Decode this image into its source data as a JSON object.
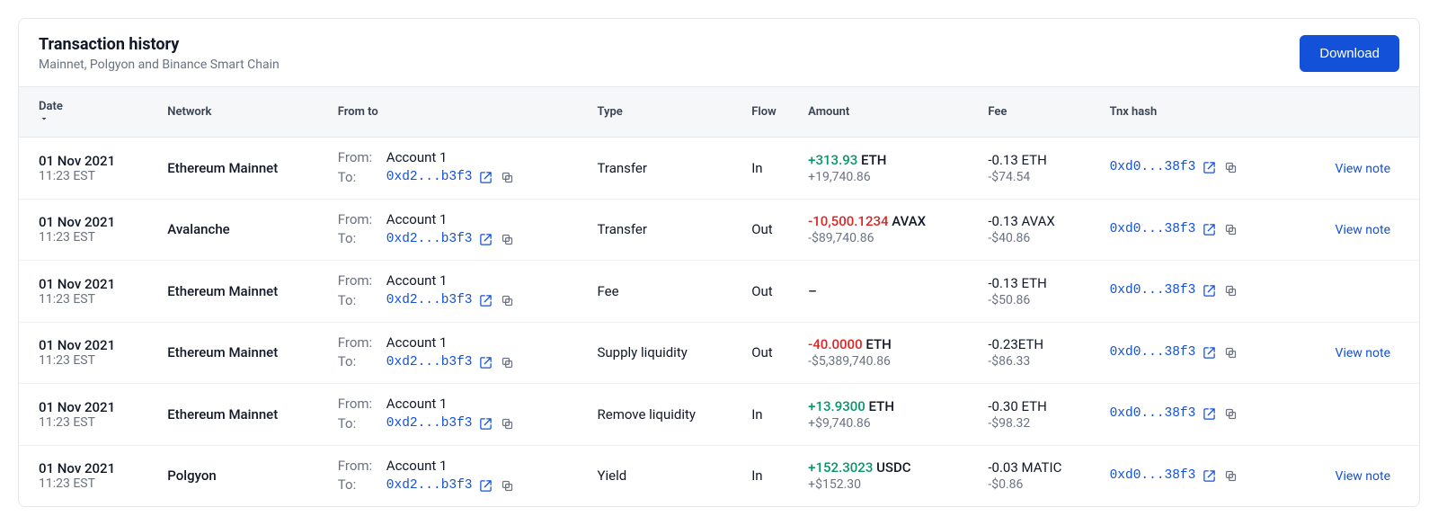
{
  "header": {
    "title": "Transaction history",
    "subtitle": "Mainnet, Polgyon and Binance Smart Chain",
    "download_label": "Download"
  },
  "columns": {
    "date": "Date",
    "network": "Network",
    "fromto": "From to",
    "type": "Type",
    "flow": "Flow",
    "amount": "Amount",
    "fee": "Fee",
    "hash": "Tnx hash"
  },
  "labels": {
    "from": "From:",
    "to": "To:",
    "view_note": "View note"
  },
  "rows": [
    {
      "date": "01 Nov 2021",
      "time": "11:23 EST",
      "network": "Ethereum Mainnet",
      "from": "Account 1",
      "to": "0xd2...b3f3",
      "type": "Transfer",
      "flow": "In",
      "amount_value": "+313.93",
      "amount_symbol": " ETH",
      "amount_class": "amt-green",
      "amount_sub": "+19,740.86",
      "fee_main": "-0.13 ETH",
      "fee_sub": "-$74.54",
      "hash": "0xd0...38f3",
      "has_note": true
    },
    {
      "date": "01 Nov 2021",
      "time": "11:23 EST",
      "network": "Avalanche",
      "from": "Account 1",
      "to": "0xd2...b3f3",
      "type": "Transfer",
      "flow": "Out",
      "amount_value": "-10,500.1234",
      "amount_symbol": " AVAX",
      "amount_class": "amt-red",
      "amount_sub": "-$89,740.86",
      "fee_main": "-0.13 AVAX",
      "fee_sub": "-$40.86",
      "hash": "0xd0...38f3",
      "has_note": true
    },
    {
      "date": "01 Nov 2021",
      "time": "11:23 EST",
      "network": "Ethereum Mainnet",
      "from": "Account 1",
      "to": "0xd2...b3f3",
      "type": "Fee",
      "flow": "Out",
      "amount_value": "–",
      "amount_symbol": "",
      "amount_class": "",
      "amount_sub": "",
      "fee_main": "-0.13 ETH",
      "fee_sub": "-$50.86",
      "hash": "0xd0...38f3",
      "has_note": false
    },
    {
      "date": "01 Nov 2021",
      "time": "11:23 EST",
      "network": "Ethereum Mainnet",
      "from": "Account 1",
      "to": "0xd2...b3f3",
      "type": "Supply liquidity",
      "flow": "Out",
      "amount_value": "-40.0000",
      "amount_symbol": " ETH",
      "amount_class": "amt-red",
      "amount_sub": "-$5,389,740.86",
      "fee_main": "-0.23ETH",
      "fee_sub": "-$86.33",
      "hash": "0xd0...38f3",
      "has_note": true
    },
    {
      "date": "01 Nov 2021",
      "time": "11:23 EST",
      "network": "Ethereum Mainnet",
      "from": "Account 1",
      "to": "0xd2...b3f3",
      "type": "Remove liquidity",
      "flow": "In",
      "amount_value": "+13.9300",
      "amount_symbol": " ETH",
      "amount_class": "amt-green",
      "amount_sub": "+$9,740.86",
      "fee_main": "-0.30 ETH",
      "fee_sub": "-$98.32",
      "hash": "0xd0...38f3",
      "has_note": false
    },
    {
      "date": "01 Nov 2021",
      "time": "11:23 EST",
      "network": "Polgyon",
      "from": "Account 1",
      "to": "0xd2...b3f3",
      "type": "Yield",
      "flow": "In",
      "amount_value": "+152.3023",
      "amount_symbol": " USDC",
      "amount_class": "amt-green",
      "amount_sub": "+$152.30",
      "fee_main": "-0.03 MATIC",
      "fee_sub": "-$0.86",
      "hash": "0xd0...38f3",
      "has_note": true
    }
  ]
}
